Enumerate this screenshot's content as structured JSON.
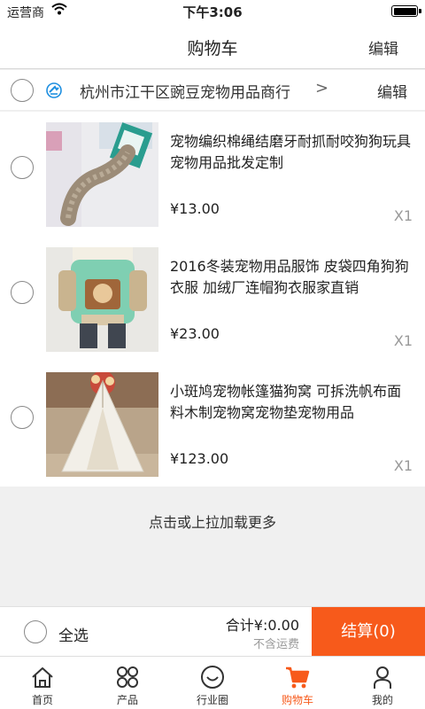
{
  "status": {
    "carrier": "运营商",
    "time": "下午3:06"
  },
  "nav": {
    "title": "购物车",
    "edit": "编辑"
  },
  "shop": {
    "name": "杭州市江干区豌豆宠物用品商行",
    "chevron": ">",
    "edit": "编辑"
  },
  "items": [
    {
      "name": "宠物编织棉绳结磨牙耐抓耐咬狗狗玩具宠物用品批发定制",
      "price": "¥13.00",
      "qty": "X1"
    },
    {
      "name": "2016冬装宠物用品服饰 皮袋四角狗狗衣服 加绒厂连帽狗衣服家直销",
      "price": "¥23.00",
      "qty": "X1"
    },
    {
      "name": "小斑鸠宠物帐篷猫狗窝 可拆洗帆布面料木制宠物窝宠物垫宠物用品",
      "price": "¥123.00",
      "qty": "X1"
    }
  ],
  "load_more": "点击或上拉加载更多",
  "footer": {
    "select_all": "全选",
    "total": "合计¥:0.00",
    "shipping": "不含运费",
    "checkout": "结算(0)"
  },
  "tabs": [
    {
      "label": "首页",
      "icon": "home-icon"
    },
    {
      "label": "产品",
      "icon": "grid-icon"
    },
    {
      "label": "行业圈",
      "icon": "smile-icon"
    },
    {
      "label": "购物车",
      "icon": "cart-icon"
    },
    {
      "label": "我的",
      "icon": "user-icon"
    }
  ],
  "colors": {
    "accent": "#f75a1b",
    "text": "#222222",
    "muted": "#999999"
  }
}
